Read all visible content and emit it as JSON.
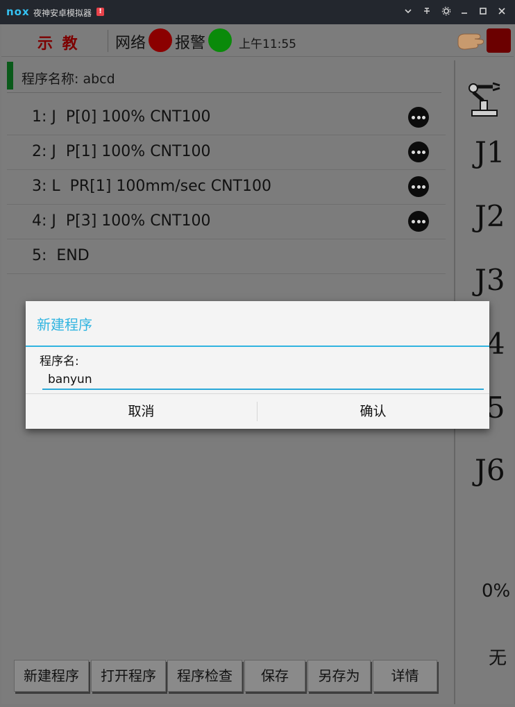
{
  "window": {
    "logo": "nox",
    "title": "夜神安卓模拟器",
    "warning_badge": "!",
    "controls": [
      "chevron-down-icon",
      "pin-icon",
      "gear-icon",
      "minimize-icon",
      "maximize-icon",
      "close-icon"
    ]
  },
  "header": {
    "mode": "示 教",
    "network_label": "网络",
    "network_status_color": "#8b0000",
    "alarm_label": "报警",
    "alarm_status_color": "#0a8a0a",
    "time": "上午11:55"
  },
  "program": {
    "name_label": "程序名称:  abcd",
    "lines": [
      {
        "text": "1: J  P[0] 100% CNT100",
        "has_more": true
      },
      {
        "text": "2: J  P[1] 100% CNT100",
        "has_more": true
      },
      {
        "text": "3: L  PR[1] 100mm/sec CNT100",
        "has_more": true
      },
      {
        "text": "4: J  P[3] 100% CNT100",
        "has_more": true
      },
      {
        "text": "5:  END",
        "has_more": false
      }
    ]
  },
  "side_panel": {
    "joints": [
      "J1",
      "J2",
      "J3",
      "J4",
      "J5",
      "J6"
    ],
    "speed": "0%",
    "tool": "无"
  },
  "toolbar": {
    "buttons": [
      "新建程序",
      "打开程序",
      "程序检查",
      "保存",
      "另存为",
      "详情"
    ]
  },
  "dialog": {
    "title": "新建程序",
    "field_label": "程序名:",
    "field_value": "banyun",
    "cancel": "取消",
    "confirm": "确认"
  },
  "colors": {
    "accent": "#30b4e0",
    "mode_text": "#7d0000"
  }
}
